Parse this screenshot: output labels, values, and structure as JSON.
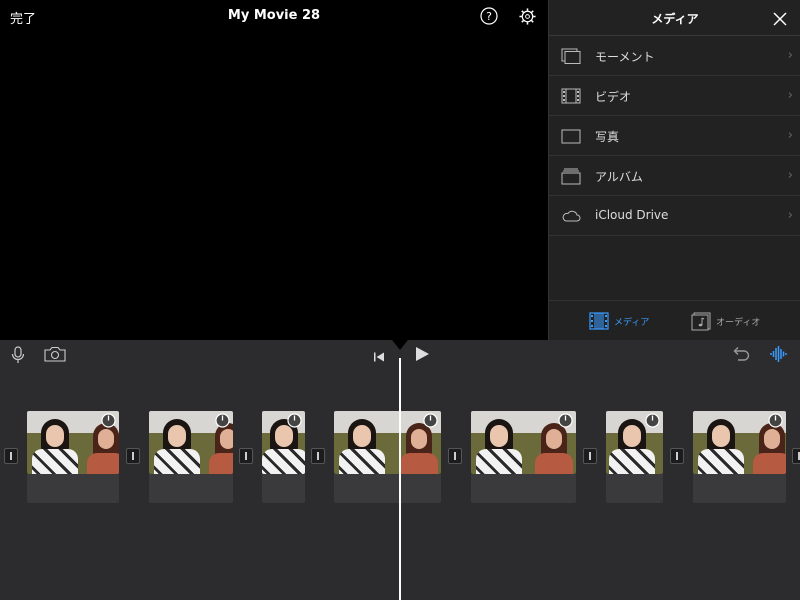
{
  "topbar": {
    "done_label": "完了",
    "title": "My Movie 28",
    "help_icon": "question-circle-icon",
    "settings_icon": "gear-icon"
  },
  "media_panel": {
    "title": "メディア",
    "close_icon": "close-icon",
    "items": [
      {
        "label": "モーメント",
        "icon": "moments-icon"
      },
      {
        "label": "ビデオ",
        "icon": "film-icon"
      },
      {
        "label": "写真",
        "icon": "photo-icon"
      },
      {
        "label": "アルバム",
        "icon": "album-icon"
      },
      {
        "label": "iCloud Drive",
        "icon": "cloud-icon"
      }
    ],
    "tabs": [
      {
        "label": "メディア",
        "icon": "film-icon",
        "selected": true
      },
      {
        "label": "オーディオ",
        "icon": "music-note-icon",
        "selected": false
      }
    ],
    "accent_color": "#3a9bff"
  },
  "timeline": {
    "clips": 7,
    "tools": [
      "microphone-icon",
      "camera-icon",
      "skip-to-start-icon",
      "play-icon",
      "undo-icon",
      "waveform-icon"
    ]
  }
}
